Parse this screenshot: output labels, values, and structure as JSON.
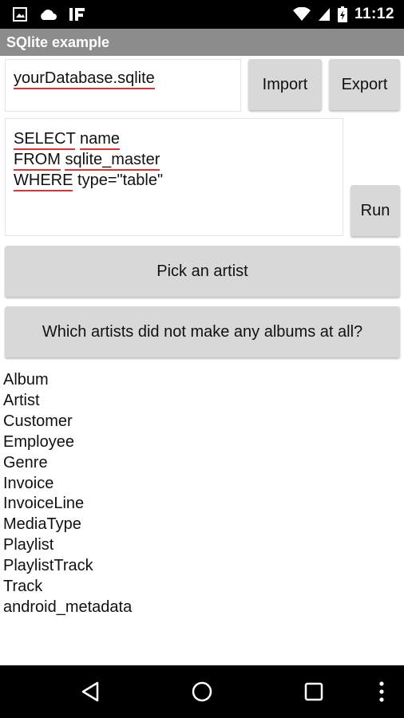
{
  "status_bar": {
    "time": "11:12",
    "left_icons": [
      "image-icon",
      "cloud-icon",
      "if-icon"
    ],
    "right_icons": [
      "wifi-icon",
      "cell-signal-icon",
      "battery-charging-icon"
    ]
  },
  "app": {
    "title": "SQlite example"
  },
  "database": {
    "filename": "yourDatabase.sqlite",
    "import_label": "Import",
    "export_label": "Export"
  },
  "query": {
    "lines": [
      [
        "SELECT",
        " ",
        "name"
      ],
      [
        "FROM",
        " ",
        "sqlite_master"
      ],
      [
        "WHERE",
        " type=\"table\"",
        ""
      ]
    ],
    "run_label": "Run"
  },
  "actions": {
    "pick_artist_label": "Pick an artist",
    "no_albums_label": "Which artists did not make any albums at all?"
  },
  "results": [
    "Album",
    "Artist",
    "Customer",
    "Employee",
    "Genre",
    "Invoice",
    "InvoiceLine",
    "MediaType",
    "Playlist",
    "PlaylistTrack",
    "Track",
    "android_metadata"
  ],
  "nav_bar": {
    "icons": [
      "back-icon",
      "home-icon",
      "recents-icon",
      "overflow-menu-icon"
    ]
  },
  "colors": {
    "title_bar": "#8c8c8c",
    "button": "#d8d8d8",
    "spellcheck_underline": "#dd3333"
  }
}
